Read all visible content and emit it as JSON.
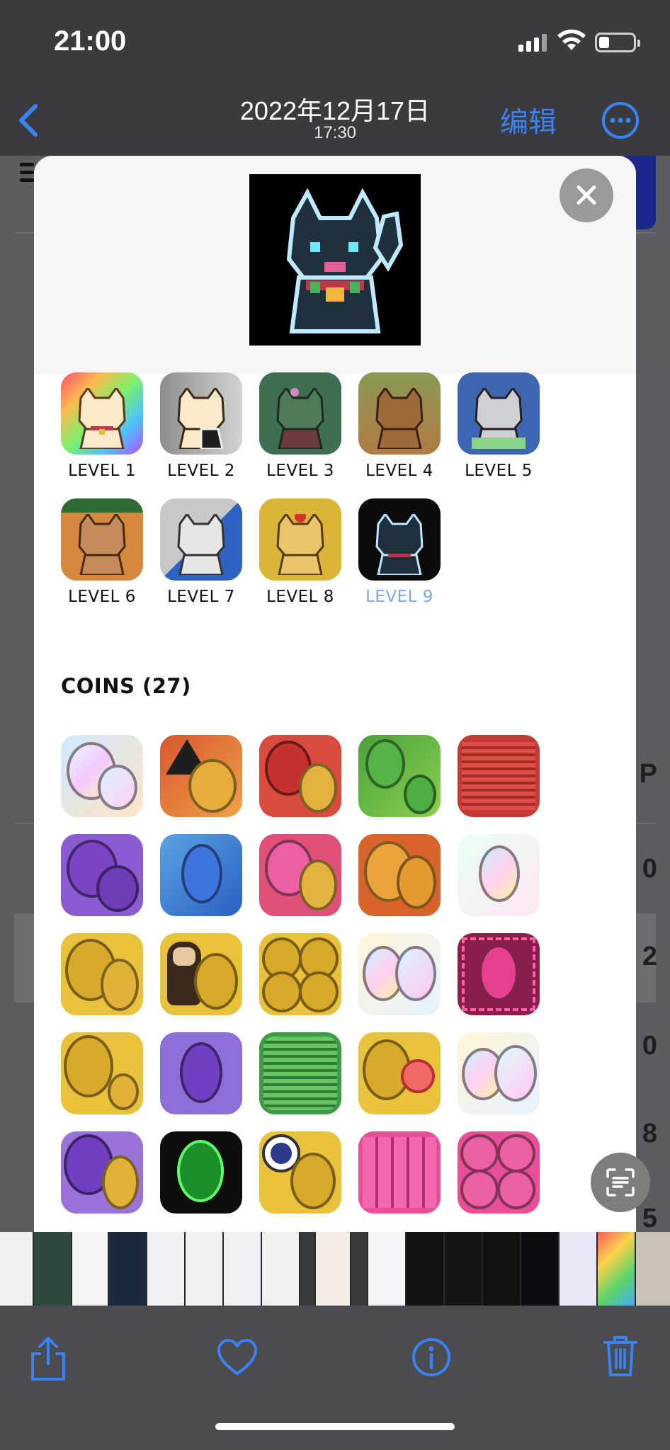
{
  "status": {
    "time": "21:00"
  },
  "nav": {
    "title": "2022年12月17日",
    "subtitle": "17:30",
    "edit": "编辑"
  },
  "levels": [
    {
      "label": "LEVEL 1",
      "active": false
    },
    {
      "label": "LEVEL 2",
      "active": false
    },
    {
      "label": "LEVEL 3",
      "active": false
    },
    {
      "label": "LEVEL 4",
      "active": false
    },
    {
      "label": "LEVEL 5",
      "active": false
    },
    {
      "label": "LEVEL 6",
      "active": false
    },
    {
      "label": "LEVEL 7",
      "active": false
    },
    {
      "label": "LEVEL 8",
      "active": false
    },
    {
      "label": "LEVEL 9",
      "active": true
    }
  ],
  "coins": {
    "title": "COINS (27)"
  },
  "background_text": [
    "P",
    "0",
    "2",
    "0",
    "8",
    "5"
  ],
  "colors": {
    "accent": "#3b82f6",
    "active_level": "#7aa7e8"
  }
}
